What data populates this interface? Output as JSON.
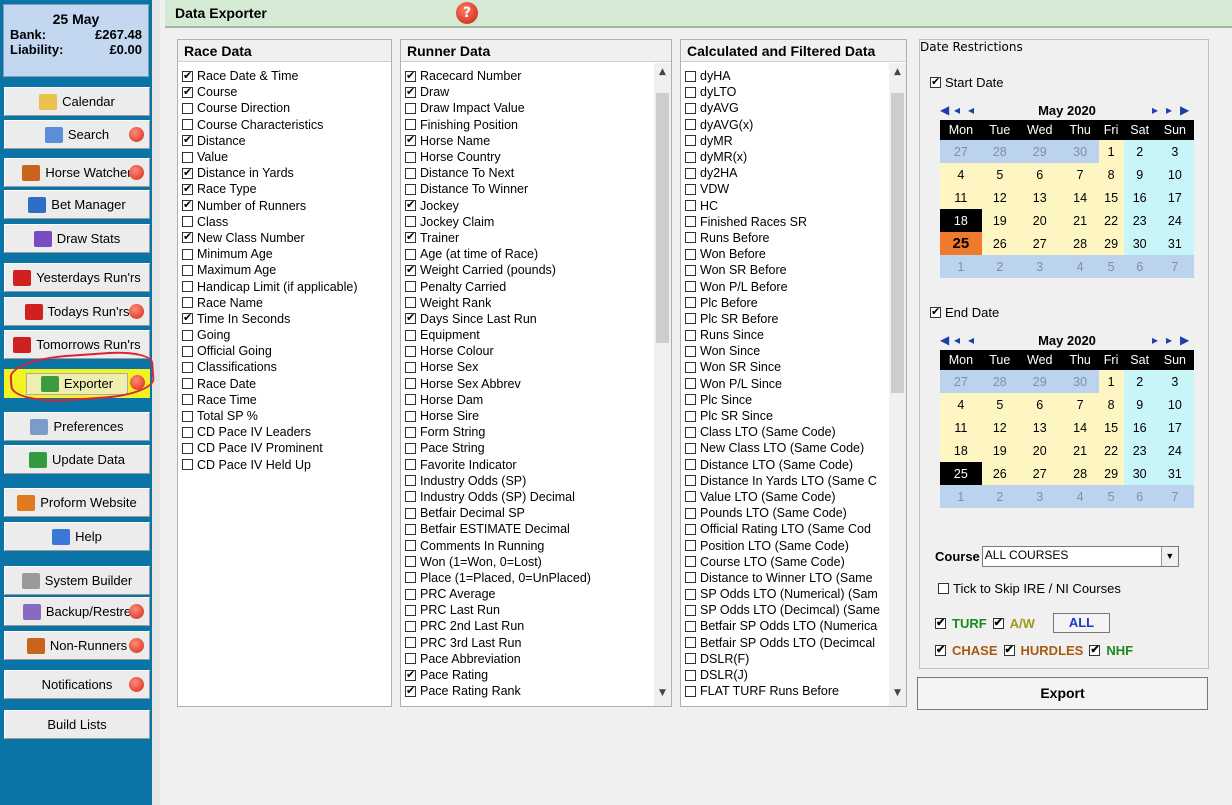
{
  "account": {
    "date": "25 May",
    "bank_label": "Bank:",
    "bank_value": "£267.48",
    "liability_label": "Liability:",
    "liability_value": "£0.00"
  },
  "sidebar": {
    "buttons": [
      {
        "label": "Calendar",
        "icon": "calendar-icon",
        "help": false
      },
      {
        "label": "Search",
        "icon": "search-icon",
        "help": true
      },
      {
        "label": "Horse Watcher",
        "icon": "horse-icon",
        "help": true
      },
      {
        "label": "Bet Manager",
        "icon": "bet-manager-icon",
        "help": false
      },
      {
        "label": "Draw Stats",
        "icon": "chart-icon",
        "help": false
      },
      {
        "label": "Yesterdays Run'rs",
        "icon": "y-icon",
        "help": false
      },
      {
        "label": "Todays Run'rs",
        "icon": "t-icon",
        "help": true
      },
      {
        "label": "Tomorrows Run'rs",
        "icon": "m-icon",
        "help": false
      },
      {
        "label": "Exporter",
        "icon": "export-icon",
        "help": true
      },
      {
        "label": "Preferences",
        "icon": "preferences-icon",
        "help": false
      },
      {
        "label": "Update Data",
        "icon": "refresh-icon",
        "help": false
      },
      {
        "label": "Proform Website",
        "icon": "home-icon",
        "help": false
      },
      {
        "label": "Help",
        "icon": "help-icon",
        "help": false
      },
      {
        "label": "System Builder",
        "icon": "system-builder-icon",
        "help": false
      },
      {
        "label": "Backup/Restre",
        "icon": "backup-icon",
        "help": true
      },
      {
        "label": "Non-Runners",
        "icon": "horse-icon",
        "help": true
      },
      {
        "label": "Notifications",
        "icon": "",
        "help": true
      },
      {
        "label": "Build Lists",
        "icon": "",
        "help": false
      }
    ]
  },
  "header": {
    "title": "Data Exporter",
    "help_glyph": "?"
  },
  "race_data": {
    "title": "Race Data",
    "items": [
      {
        "label": "Race Date & Time",
        "checked": true
      },
      {
        "label": "Course",
        "checked": true
      },
      {
        "label": "Course Direction",
        "checked": false
      },
      {
        "label": "Course Characteristics",
        "checked": false
      },
      {
        "label": "Distance",
        "checked": true
      },
      {
        "label": "Value",
        "checked": false
      },
      {
        "label": "Distance in Yards",
        "checked": true
      },
      {
        "label": "Race Type",
        "checked": true
      },
      {
        "label": "Number of Runners",
        "checked": true
      },
      {
        "label": "Class",
        "checked": false
      },
      {
        "label": "New Class Number",
        "checked": true
      },
      {
        "label": "Minimum Age",
        "checked": false
      },
      {
        "label": "Maximum Age",
        "checked": false
      },
      {
        "label": "Handicap Limit (if applicable)",
        "checked": false
      },
      {
        "label": "Race Name",
        "checked": false
      },
      {
        "label": "Time In Seconds",
        "checked": true
      },
      {
        "label": "Going",
        "checked": false
      },
      {
        "label": "Official Going",
        "checked": false
      },
      {
        "label": "Classifications",
        "checked": false
      },
      {
        "label": "Race Date",
        "checked": false
      },
      {
        "label": "Race Time",
        "checked": false
      },
      {
        "label": "Total SP %",
        "checked": false
      },
      {
        "label": "CD Pace IV Leaders",
        "checked": false
      },
      {
        "label": "CD Pace IV Prominent",
        "checked": false
      },
      {
        "label": "CD Pace IV Held Up",
        "checked": false
      }
    ]
  },
  "runner_data": {
    "title": "Runner Data",
    "items": [
      {
        "label": "Racecard Number",
        "checked": true
      },
      {
        "label": "Draw",
        "checked": true
      },
      {
        "label": "Draw Impact Value",
        "checked": false
      },
      {
        "label": "Finishing Position",
        "checked": false
      },
      {
        "label": "Horse Name",
        "checked": true
      },
      {
        "label": "Horse Country",
        "checked": false
      },
      {
        "label": "Distance To Next",
        "checked": false
      },
      {
        "label": "Distance To Winner",
        "checked": false
      },
      {
        "label": "Jockey",
        "checked": true
      },
      {
        "label": "Jockey Claim",
        "checked": false
      },
      {
        "label": "Trainer",
        "checked": true
      },
      {
        "label": "Age (at time of Race)",
        "checked": false
      },
      {
        "label": "Weight Carried (pounds)",
        "checked": true
      },
      {
        "label": "Penalty Carried",
        "checked": false
      },
      {
        "label": "Weight Rank",
        "checked": false
      },
      {
        "label": "Days Since Last Run",
        "checked": true
      },
      {
        "label": "Equipment",
        "checked": false
      },
      {
        "label": "Horse Colour",
        "checked": false
      },
      {
        "label": "Horse Sex",
        "checked": false
      },
      {
        "label": "Horse Sex Abbrev",
        "checked": false
      },
      {
        "label": "Horse Dam",
        "checked": false
      },
      {
        "label": "Horse Sire",
        "checked": false
      },
      {
        "label": "Form String",
        "checked": false
      },
      {
        "label": "Pace String",
        "checked": false
      },
      {
        "label": "Favorite Indicator",
        "checked": false
      },
      {
        "label": "Industry Odds (SP)",
        "checked": false
      },
      {
        "label": "Industry Odds (SP) Decimal",
        "checked": false
      },
      {
        "label": "Betfair Decimal SP",
        "checked": false
      },
      {
        "label": "Betfair ESTIMATE Decimal",
        "checked": false
      },
      {
        "label": "Comments In Running",
        "checked": false
      },
      {
        "label": "Won (1=Won, 0=Lost)",
        "checked": false
      },
      {
        "label": "Place (1=Placed, 0=UnPlaced)",
        "checked": false
      },
      {
        "label": "PRC Average",
        "checked": false
      },
      {
        "label": "PRC Last Run",
        "checked": false
      },
      {
        "label": "PRC 2nd Last Run",
        "checked": false
      },
      {
        "label": "PRC 3rd Last Run",
        "checked": false
      },
      {
        "label": "Pace Abbreviation",
        "checked": false
      },
      {
        "label": "Pace Rating",
        "checked": true
      },
      {
        "label": "Pace Rating Rank",
        "checked": true
      }
    ]
  },
  "calc_data": {
    "title": "Calculated and Filtered Data",
    "items": [
      {
        "label": "dyHA",
        "checked": false
      },
      {
        "label": "dyLTO",
        "checked": false
      },
      {
        "label": "dyAVG",
        "checked": false
      },
      {
        "label": "dyAVG(x)",
        "checked": false
      },
      {
        "label": "dyMR",
        "checked": false
      },
      {
        "label": "dyMR(x)",
        "checked": false
      },
      {
        "label": "dy2HA",
        "checked": false
      },
      {
        "label": "VDW",
        "checked": false
      },
      {
        "label": "HC",
        "checked": false
      },
      {
        "label": "Finished Races SR",
        "checked": false
      },
      {
        "label": "Runs Before",
        "checked": false
      },
      {
        "label": "Won Before",
        "checked": false
      },
      {
        "label": "Won SR Before",
        "checked": false
      },
      {
        "label": "Won P/L Before",
        "checked": false
      },
      {
        "label": "Plc Before",
        "checked": false
      },
      {
        "label": "Plc SR Before",
        "checked": false
      },
      {
        "label": "Runs Since",
        "checked": false
      },
      {
        "label": "Won Since",
        "checked": false
      },
      {
        "label": "Won SR Since",
        "checked": false
      },
      {
        "label": "Won P/L Since",
        "checked": false
      },
      {
        "label": "Plc Since",
        "checked": false
      },
      {
        "label": "Plc SR Since",
        "checked": false
      },
      {
        "label": "Class LTO (Same Code)",
        "checked": false
      },
      {
        "label": "New Class LTO (Same Code)",
        "checked": false
      },
      {
        "label": "Distance LTO (Same Code)",
        "checked": false
      },
      {
        "label": "Distance In Yards LTO (Same C",
        "checked": false
      },
      {
        "label": "Value LTO (Same Code)",
        "checked": false
      },
      {
        "label": "Pounds LTO (Same Code)",
        "checked": false
      },
      {
        "label": "Official Rating LTO (Same Cod",
        "checked": false
      },
      {
        "label": "Position LTO (Same Code)",
        "checked": false
      },
      {
        "label": "Course LTO (Same Code)",
        "checked": false
      },
      {
        "label": "Distance to Winner LTO (Same",
        "checked": false
      },
      {
        "label": "SP Odds LTO (Numerical) (Sam",
        "checked": false
      },
      {
        "label": "SP Odds LTO (Decimcal) (Same",
        "checked": false
      },
      {
        "label": "Betfair SP Odds LTO (Numerica",
        "checked": false
      },
      {
        "label": "Betfair SP Odds LTO (Decimcal",
        "checked": false
      },
      {
        "label": "DSLR(F)",
        "checked": false
      },
      {
        "label": "DSLR(J)",
        "checked": false
      },
      {
        "label": "FLAT TURF Runs Before",
        "checked": false
      }
    ]
  },
  "date_restrictions": {
    "title": "Date Restrictions",
    "start": {
      "label": "Start Date",
      "checked": true,
      "month": "May 2020",
      "selected": 18,
      "today": 25
    },
    "end": {
      "label": "End Date",
      "checked": true,
      "month": "May 2020",
      "selected": 25
    },
    "weekdays": [
      "Mon",
      "Tue",
      "Wed",
      "Thu",
      "Fri",
      "Sat",
      "Sun"
    ],
    "weeks": [
      [
        27,
        28,
        29,
        30,
        1,
        2,
        3
      ],
      [
        4,
        5,
        6,
        7,
        8,
        9,
        10
      ],
      [
        11,
        12,
        13,
        14,
        15,
        16,
        17
      ],
      [
        18,
        19,
        20,
        21,
        22,
        23,
        24
      ],
      [
        25,
        26,
        27,
        28,
        29,
        30,
        31
      ],
      [
        1,
        2,
        3,
        4,
        5,
        6,
        7
      ]
    ],
    "course_label": "Course",
    "course_value": "ALL COURSES",
    "skip_label": "Tick to Skip IRE / NI Courses",
    "skip_checked": false,
    "turf": {
      "label": "TURF",
      "checked": true,
      "color": "#1a8a1a"
    },
    "aw": {
      "label": "A/W",
      "checked": true,
      "color": "#9c9c1a"
    },
    "all_label": "ALL",
    "chase": {
      "label": "CHASE",
      "checked": true,
      "color": "#a85a14"
    },
    "hurdles": {
      "label": "HURDLES",
      "checked": true,
      "color": "#a85a14"
    },
    "nhf": {
      "label": "NHF",
      "checked": true,
      "color": "#1a8a1a"
    }
  },
  "export_label": "Export"
}
